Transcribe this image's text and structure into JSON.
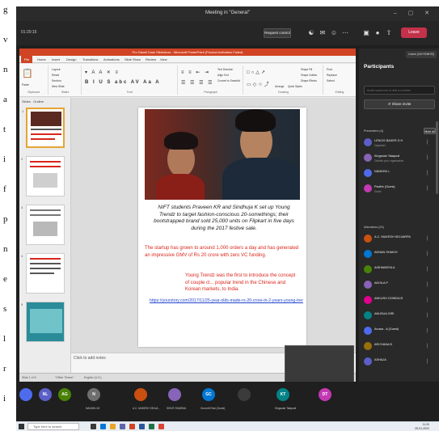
{
  "left_strip": {
    "fragments": [
      "g",
      "v",
      "n",
      "a",
      "t",
      "i",
      "f",
      "p",
      "n",
      "e",
      "s",
      "l",
      "r",
      "i"
    ]
  },
  "titlebar": {
    "title": "Meeting in \"General\"",
    "window_controls": "– ▢ ✕"
  },
  "meeting": {
    "timer": "01:20:15",
    "request_control": "Request control",
    "leave": "Leave",
    "leave_tooltip": "Leave (Ctrl+Shift+B)"
  },
  "ppt": {
    "window_title": "Pro Diwali Case Slideshow - Microsoft PowerPoint (Product Activation Failed)",
    "file_tab": "File",
    "tabs": [
      "Home",
      "Insert",
      "Design",
      "Transitions",
      "Animations",
      "Slide Show",
      "Review",
      "View"
    ],
    "ribbon_groups": [
      "Clipboard",
      "Slides",
      "Font",
      "Paragraph",
      "Drawing",
      "Editing"
    ],
    "ribbon_items": {
      "paste": "Paste",
      "new_slide": "New Slide",
      "layout": "Layout",
      "reset": "Reset",
      "section": "Section",
      "text_direction": "Text Direction",
      "align_text": "Align Text",
      "convert_smartart": "Convert to SmartArt",
      "arrange": "Arrange",
      "quick_styles": "Quick Styles",
      "shape_fill": "Shape Fill",
      "shape_outline": "Shape Outline",
      "shape_effects": "Shape Effects",
      "find": "Find",
      "replace": "Replace",
      "select": "Select"
    },
    "pane_tabs": [
      "Slides",
      "Outline"
    ],
    "thumb_numbers": [
      "1",
      "2",
      "3",
      "4",
      "5"
    ],
    "slide": {
      "quote": "NIFT students Praveen KR and Sindhuja K set up Young Trendz to target fashion-conscious 20-somethings; their bootstrapped brand sold 25,000 units on Flipkart in five days during the 2017 festive sale.",
      "red_para1": "The startup has grown to around 1,000 orders a day and has generated an impressive GMV of Rs 20 crore with zero VC funding.",
      "red_para2": "Young Trendz was the first to introduce the concept of couple cl... popular trend in the Chinese and Korean markets, to India.",
      "link": "https://yourstory.com/2017/11/25-year-olds-made-rs-20-crore-in-2-years-young-trendz"
    },
    "notes_placeholder": "Click to add notes",
    "status": {
      "slide": "Slide 1 of 5",
      "theme": "\"Office Theme\"",
      "language": "English (U.S.)"
    }
  },
  "panel": {
    "title": "Participants",
    "invite_placeholder": "Invite someone or dial a number",
    "share_invite": "Share invite",
    "presenters_heading": "Presenters (4)",
    "mute_all": "Mute all",
    "attendees_heading": "Attendees (24)",
    "presenters": [
      {
        "name": "LENCIS BAKER D H",
        "sub": "Organizer",
        "color": "#5b5fc7",
        "initials": "LB"
      },
      {
        "name": "Kingsolar Tatapudi",
        "sub": "Outside your organization",
        "color": "#8764b8",
        "initials": "KT"
      },
      {
        "name": "NANDHU L",
        "sub": "",
        "color": "#4f6bed",
        "initials": "NL"
      },
      {
        "name": "Pavithr (Guest)",
        "sub": "Guest",
        "color": "#c239b3",
        "initials": "PG"
      }
    ],
    "attendees": [
      {
        "name": "A.C. MUKESH SELVARPA",
        "color": "#ca5010",
        "initials": "AM"
      },
      {
        "name": "ADNAN SHAIKH",
        "color": "#0078d4",
        "initials": "AS"
      },
      {
        "name": "AISHWARYA A",
        "color": "#498205",
        "initials": "AA"
      },
      {
        "name": "AKHILA P",
        "color": "#8764b8",
        "initials": "AP"
      },
      {
        "name": "ANKUSH GOWDA B",
        "color": "#e3008c",
        "initials": "AG"
      },
      {
        "name": "ANUSUA GIRI",
        "color": "#038387",
        "initials": "AG"
      },
      {
        "name": "Amara . A (Guest)",
        "color": "#4f6bed",
        "initials": "AA"
      },
      {
        "name": "ARCHANA B",
        "color": "#986f0b",
        "initials": "AB"
      },
      {
        "name": "ASHAJA",
        "color": "#5b5fc7",
        "initials": "AS"
      }
    ]
  },
  "tiles": [
    {
      "initials": "",
      "label": "",
      "color": "#4f6bed"
    },
    {
      "initials": "NL",
      "label": "",
      "color": "#5b5fc7"
    },
    {
      "initials": "AG",
      "label": "",
      "color": "#498205"
    },
    {
      "initials": "N",
      "label": "NANDHU M",
      "color": "#6e6e6e"
    },
    {
      "initials": "",
      "label": "A.C. MUKESH SELVA...",
      "color": "#ca5010"
    },
    {
      "initials": "",
      "label": "SHIVE SHARMA",
      "color": "#8764b8"
    },
    {
      "initials": "GC",
      "label": "Gurunth Ravi (Guest)",
      "color": "#0078d4"
    },
    {
      "initials": "",
      "label": "",
      "color": "#3b3b3b"
    },
    {
      "initials": "KT",
      "label": "Kingsolar Tatapudi",
      "color": "#038387"
    },
    {
      "initials": "DT",
      "label": "",
      "color": "#c239b3"
    }
  ],
  "taskbar": {
    "search_placeholder": "Type here to search",
    "time": "11:20",
    "date": "25-01-2022"
  },
  "colors": {
    "teams_bg": "#1f1f1f",
    "leave_red": "#c4314b",
    "ppt_orange": "#d04423",
    "slide_red": "#d9261c",
    "link_blue": "#2244cc"
  }
}
